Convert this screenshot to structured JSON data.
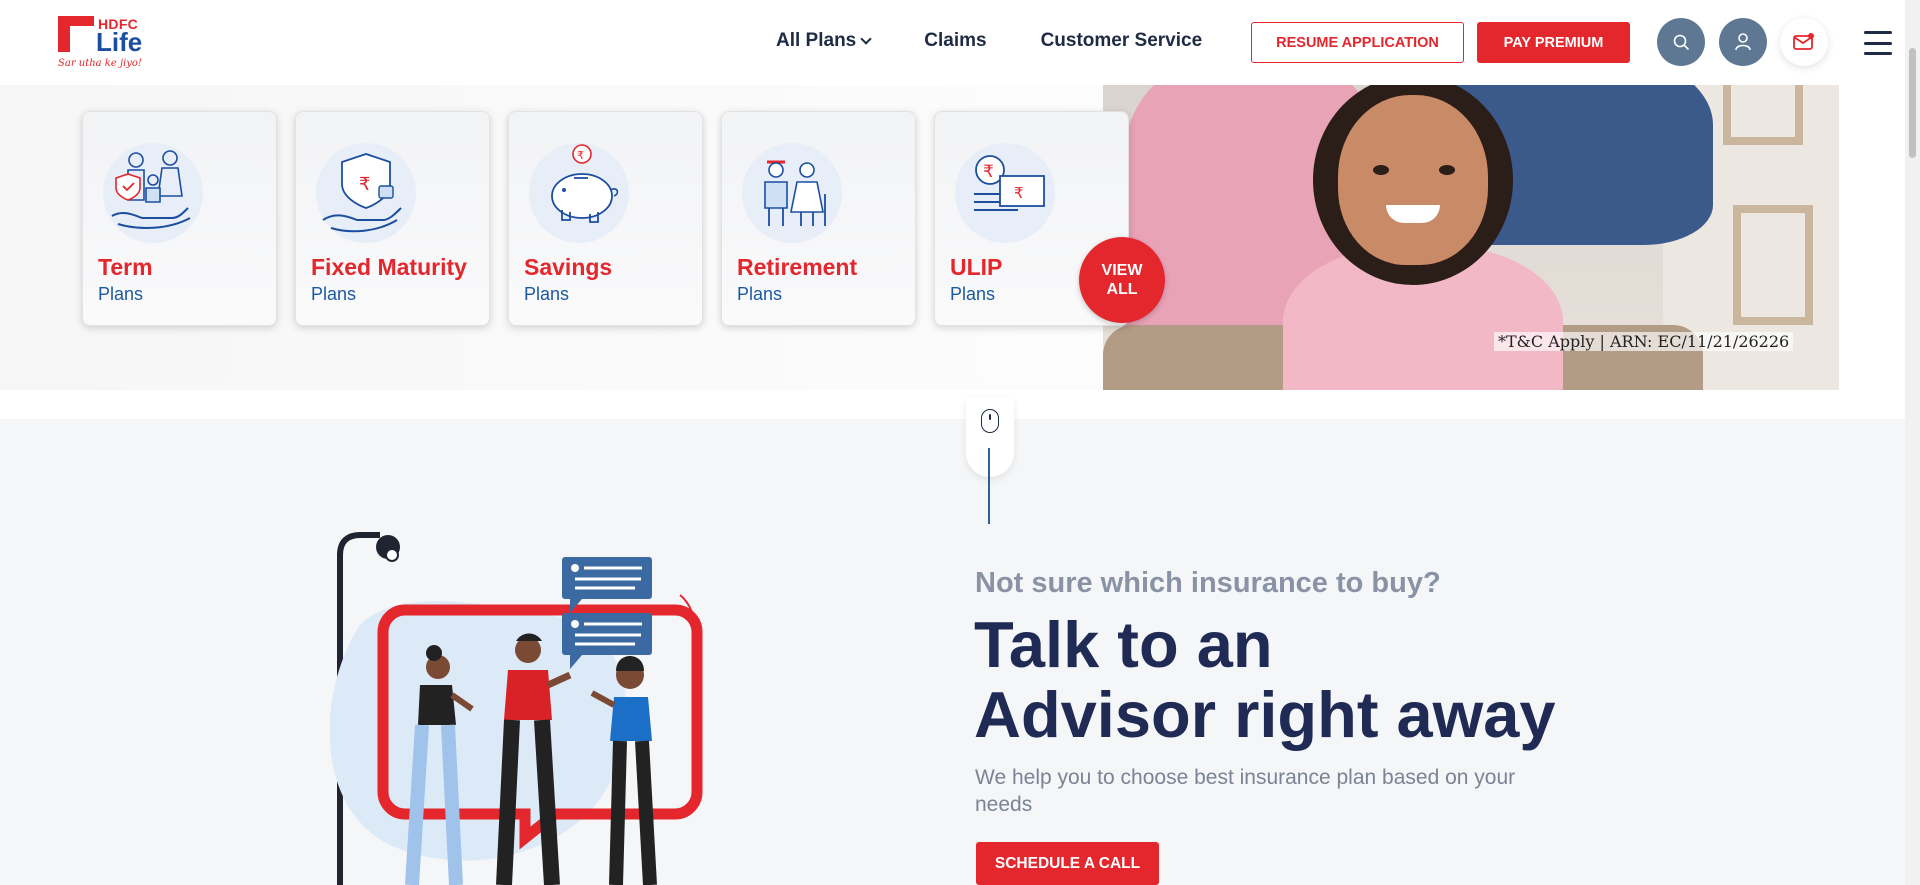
{
  "brand": {
    "name": "HDFC",
    "product": "Life",
    "tagline": "Sar utha ke jiyo!",
    "primary_color": "#e4262d",
    "secondary_color": "#1c4ea0"
  },
  "nav": {
    "items": [
      {
        "label": "All Plans",
        "has_dropdown": true
      },
      {
        "label": "Claims"
      },
      {
        "label": "Customer Service"
      }
    ]
  },
  "header_actions": {
    "resume_label": "RESUME APPLICATION",
    "pay_label": "PAY PREMIUM",
    "icons": [
      "search-icon",
      "user-icon",
      "contact-icon",
      "hamburger-menu-icon"
    ]
  },
  "plans": [
    {
      "title": "Term",
      "sub": "Plans",
      "icon": "family-protection-icon"
    },
    {
      "title": "Fixed Maturity",
      "sub": "Plans",
      "icon": "rupee-shield-hand-icon"
    },
    {
      "title": "Savings",
      "sub": "Plans",
      "icon": "piggy-bank-icon"
    },
    {
      "title": "Retirement",
      "sub": "Plans",
      "icon": "elderly-couple-icon"
    },
    {
      "title": "ULIP",
      "sub": "Plans",
      "icon": "rupee-coins-notes-icon"
    }
  ],
  "view_all": {
    "line1": "VIEW",
    "line2": "ALL"
  },
  "hero": {
    "disclaimer": "*T&C Apply | ARN: EC/11/21/26226"
  },
  "advisor": {
    "question": "Not sure which insurance to buy?",
    "title_line1": "Talk to an",
    "title_line2": "Advisor right away",
    "description": "We help you to choose best insurance plan based on your needs",
    "cta_label": "SCHEDULE A CALL"
  }
}
